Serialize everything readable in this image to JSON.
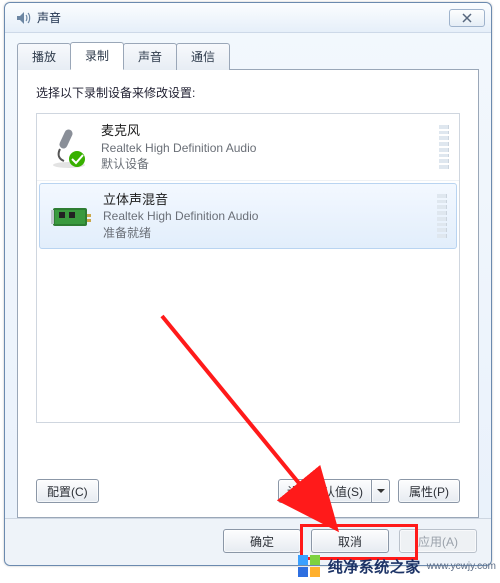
{
  "window": {
    "title": "声音",
    "close_icon": "close-icon"
  },
  "tabs": [
    {
      "label": "播放",
      "active": false
    },
    {
      "label": "录制",
      "active": true
    },
    {
      "label": "声音",
      "active": false
    },
    {
      "label": "通信",
      "active": false
    }
  ],
  "panel": {
    "instruction": "选择以下录制设备来修改设置:",
    "devices": [
      {
        "name": "麦克风",
        "desc": "Realtek High Definition Audio",
        "status": "默认设备",
        "icon": "microphone",
        "default_badge": true,
        "selected": false
      },
      {
        "name": "立体声混音",
        "desc": "Realtek High Definition Audio",
        "status": "准备就绪",
        "icon": "soundcard",
        "default_badge": false,
        "selected": true
      }
    ],
    "buttons": {
      "configure": "配置(C)",
      "set_default": "设为默认值(S)",
      "properties": "属性(P)"
    }
  },
  "footer": {
    "ok": "确定",
    "cancel": "取消",
    "apply": "应用(A)"
  },
  "watermark": {
    "text": "纯净系统之家",
    "sub": "www.ycwjy.com"
  }
}
